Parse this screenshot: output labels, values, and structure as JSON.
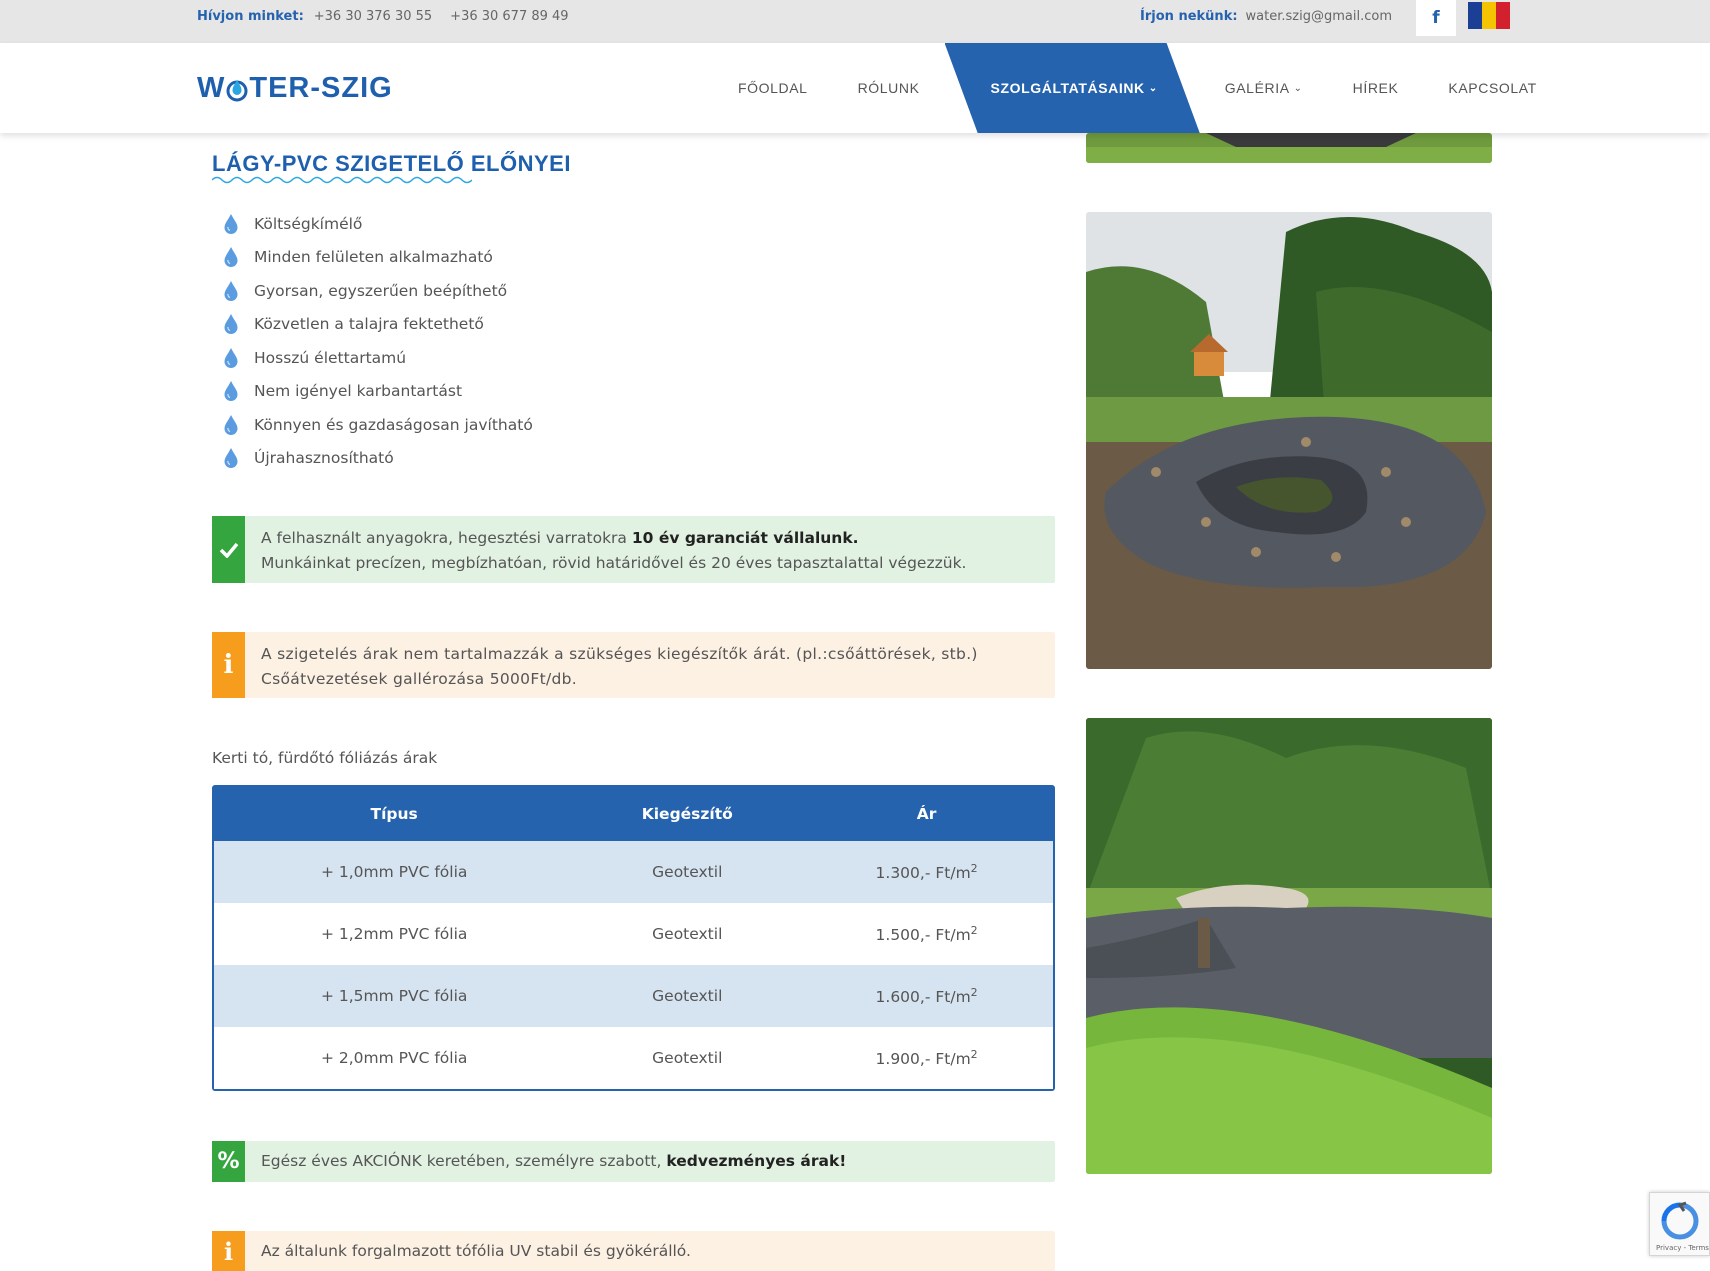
{
  "topbar": {
    "call_label": "Hívjon minket:",
    "phone1": "+36 30 376 30 55",
    "phone2": "+36 30 677 89 49",
    "write_label": "Írjon nekünk:",
    "email": "water.szig@gmail.com",
    "facebook_icon": "f"
  },
  "header": {
    "logo_left": "W",
    "logo_right": "TER-SZIG",
    "nav": [
      {
        "label": "FŐOLDAL"
      },
      {
        "label": "RÓLUNK"
      },
      {
        "label": "SZOLGÁLTATÁSAINK"
      },
      {
        "label": "GALÉRIA"
      },
      {
        "label": "HÍREK"
      },
      {
        "label": "KAPCSOLAT"
      }
    ]
  },
  "main": {
    "title": "LÁGY-PVC SZIGETELŐ ELŐNYEI",
    "benefits": [
      "Költségkímélő",
      "Minden felületen alkalmazható",
      "Gyorsan, egyszerűen beépíthető",
      "Közvetlen a talajra fektethető",
      "Hosszú élettartamú",
      "Nem igényel karbantartást",
      "Könnyen és gazdaságosan javítható",
      "Újrahasznosítható"
    ],
    "guarantee": {
      "text1": "A felhasznált anyagokra, hegesztési varratokra ",
      "bold": "10 év garanciát vállalunk.",
      "text2": "Munkáinkat precízen, megbízhatóan, rövid határidővel és 20 éves tapasztalattal végezzük."
    },
    "info1": {
      "line1": "A szigetelés árak nem tartalmazzák a szükséges kiegészítők árát. (pl.:csőáttörések, stb.)",
      "line2": "Csőátvezetések gallérozása 5000Ft/db."
    },
    "table_caption": "Kerti tó, fürdőtó fóliázás árak",
    "table": {
      "headers": [
        "Típus",
        "Kiegészítő",
        "Ár"
      ],
      "rows": [
        {
          "type": "+ 1,0mm PVC fólia",
          "extra": "Geotextil",
          "price": "1.300,- Ft/m",
          "sup": "2"
        },
        {
          "type": "+ 1,2mm PVC fólia",
          "extra": "Geotextil",
          "price": "1.500,- Ft/m",
          "sup": "2"
        },
        {
          "type": "+ 1,5mm PVC fólia",
          "extra": "Geotextil",
          "price": "1.600,- Ft/m",
          "sup": "2"
        },
        {
          "type": "+ 2,0mm PVC fólia",
          "extra": "Geotextil",
          "price": "1.900,- Ft/m",
          "sup": "2"
        }
      ]
    },
    "promo": {
      "text": "Egész éves AKCIÓNK keretében, személyre szabott, ",
      "bold": "kedvezményes árak!"
    },
    "info2": {
      "text": "Az általunk forgalmazott tófólia UV stabil és gyökérálló."
    }
  },
  "recaptcha": {
    "text": "Privacy - Terms"
  },
  "colors": {
    "brand": "#2563ae",
    "green": "#35a53f",
    "orange": "#f69d1d"
  }
}
